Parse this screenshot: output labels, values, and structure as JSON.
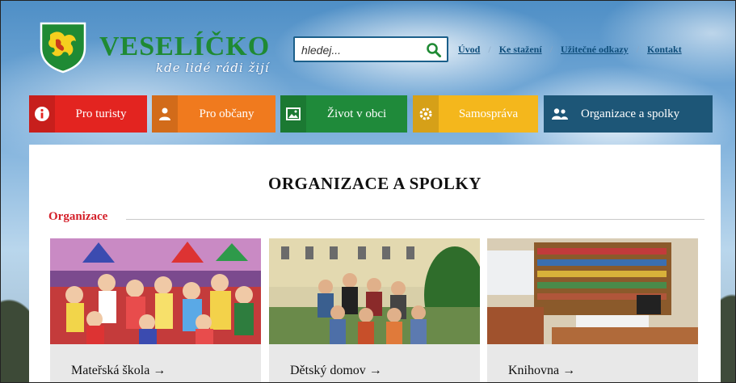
{
  "brand": {
    "title": "VESELÍČKO",
    "tagline": "kde lidé rádi žijí"
  },
  "search": {
    "placeholder": "hledej..."
  },
  "toplinks": [
    {
      "label": "Úvod"
    },
    {
      "label": "Ke stažení"
    },
    {
      "label": "Užitečné odkazy"
    },
    {
      "label": "Kontakt"
    }
  ],
  "nav": [
    {
      "label": "Pro turisty",
      "color": "#e32420",
      "icon": "info-icon"
    },
    {
      "label": "Pro občany",
      "color": "#f07a1e",
      "icon": "person-icon"
    },
    {
      "label": "Život v obci",
      "color": "#1f8a3a",
      "icon": "picture-icon"
    },
    {
      "label": "Samospráva",
      "color": "#f4b71c",
      "icon": "gear-icon"
    },
    {
      "label": "Organizace a spolky",
      "color": "#1d5677",
      "icon": "people-icon"
    }
  ],
  "main": {
    "title": "ORGANIZACE A SPOLKY",
    "section": "Organizace",
    "cards": [
      {
        "label": "Mateřská škola →"
      },
      {
        "label": "Dětský domov →"
      },
      {
        "label": "Knihovna →"
      }
    ]
  }
}
